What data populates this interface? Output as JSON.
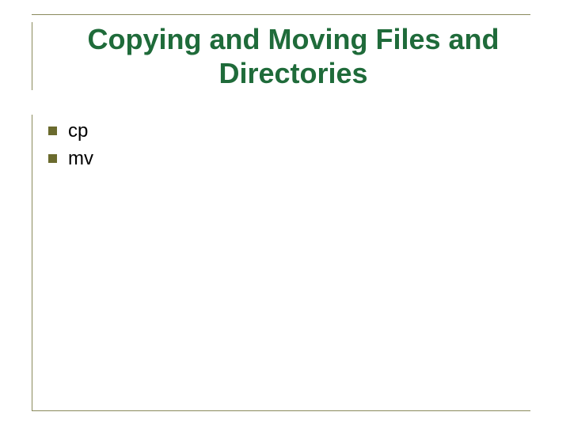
{
  "slide": {
    "title": "Copying and Moving Files and Directories",
    "bullets": [
      {
        "text": "cp"
      },
      {
        "text": "mv"
      }
    ]
  },
  "colors": {
    "title": "#1f6b3a",
    "bullet_marker": "#6b6b2e",
    "border": "#8a8a5c",
    "body_text": "#000000"
  }
}
